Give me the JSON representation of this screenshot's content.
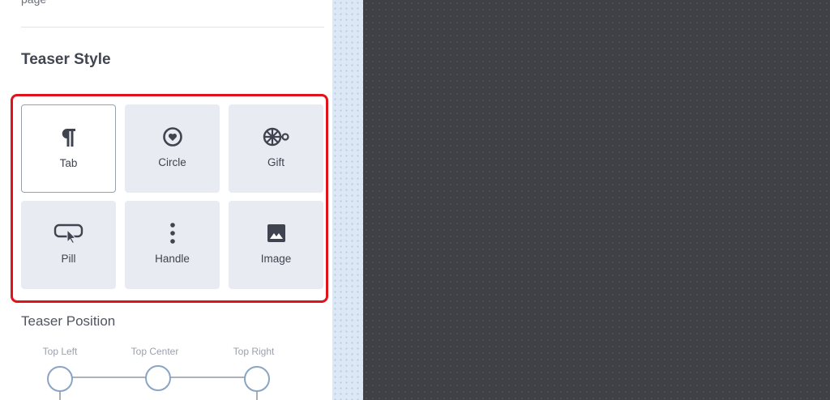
{
  "panel": {
    "previous_text": "page",
    "teaser_style": {
      "title": "Teaser Style",
      "selected": "Tab",
      "options": [
        {
          "label": "Tab",
          "icon": "paragraph-icon"
        },
        {
          "label": "Circle",
          "icon": "heart-circle-icon"
        },
        {
          "label": "Gift",
          "icon": "gift-icon"
        },
        {
          "label": "Pill",
          "icon": "pill-cursor-icon"
        },
        {
          "label": "Handle",
          "icon": "vertical-dots-icon"
        },
        {
          "label": "Image",
          "icon": "image-icon"
        }
      ]
    },
    "teaser_position": {
      "title": "Teaser Position",
      "options": [
        "Top Left",
        "Top Center",
        "Top Right"
      ]
    }
  },
  "colors": {
    "highlight": "#e0131b",
    "tile_bg": "#e9ebf2",
    "selected_border": "#9aa0aa",
    "icon": "#3f4450",
    "preview_bg": "#3f4146",
    "strip_bg": "#dce8f5"
  }
}
